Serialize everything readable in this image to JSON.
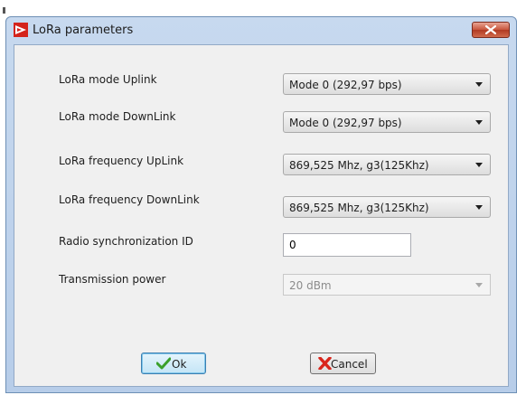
{
  "window": {
    "title": "LoRa parameters"
  },
  "form": {
    "mode_uplink": {
      "label": "LoRa mode Uplink",
      "value": "Mode 0 (292,97 bps)"
    },
    "mode_downlink": {
      "label": "LoRa mode DownLink",
      "value": "Mode 0 (292,97 bps)"
    },
    "freq_uplink": {
      "label": "LoRa frequency UpLink",
      "value": "869,525 Mhz, g3(125Khz)"
    },
    "freq_downlink": {
      "label": "LoRa frequency DownLink",
      "value": "869,525 Mhz, g3(125Khz)"
    },
    "sync_id": {
      "label": "Radio synchronization ID",
      "value": "0"
    },
    "tx_power": {
      "label": "Transmission power",
      "value": "20 dBm",
      "disabled": true
    }
  },
  "buttons": {
    "ok_label": "Ok",
    "cancel_label": "Cancel"
  },
  "icons": {
    "app": "app-logo-icon",
    "close": "close-icon",
    "ok": "checkmark-icon",
    "cancel": "red-x-icon"
  },
  "colors": {
    "close_button": "#c8543c",
    "ok_check": "#3aa02b",
    "cancel_x": "#d9261c",
    "app_icon": "#d4231b"
  }
}
